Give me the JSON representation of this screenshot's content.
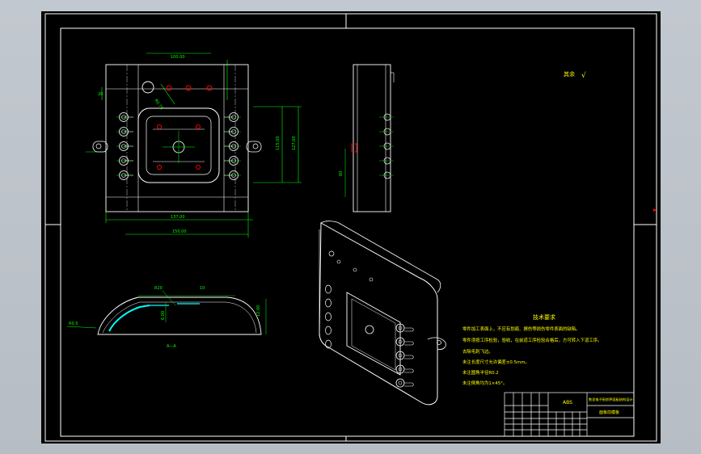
{
  "roughness": {
    "label": "其余",
    "symbol": "√"
  },
  "section_label": "A—A",
  "notes": {
    "title": "技术要求",
    "lines": [
      "零件加工表面上，不应有划痕、擦伤等损伤零件表面的缺陷。",
      "零件须按工序检验，验收，在前道工序检验合格后，方可转入下道工序。",
      "去除毛刺飞边。",
      "未注长度尺寸允许偏差±0.5mm。",
      "未注圆角半径R0.2",
      "未注倒角均为1×45°。"
    ]
  },
  "title_block": {
    "material": "ABS",
    "part_name": "数显电子厨房秤面板结构设计",
    "drawing_name": "面板前模板"
  },
  "dimensions": {
    "top_width": "100.00",
    "left_height": "20",
    "hole_offset": "R0.75",
    "right_height_1": "115.00",
    "right_height_2": "127.00",
    "bottom_inner": "137.00",
    "bottom_outer": "150.00",
    "section_height": "12.00",
    "section_depth": "6.00",
    "section_top": "R20",
    "section_slot": "10",
    "section_left": "R0.5",
    "side_height": "60"
  }
}
